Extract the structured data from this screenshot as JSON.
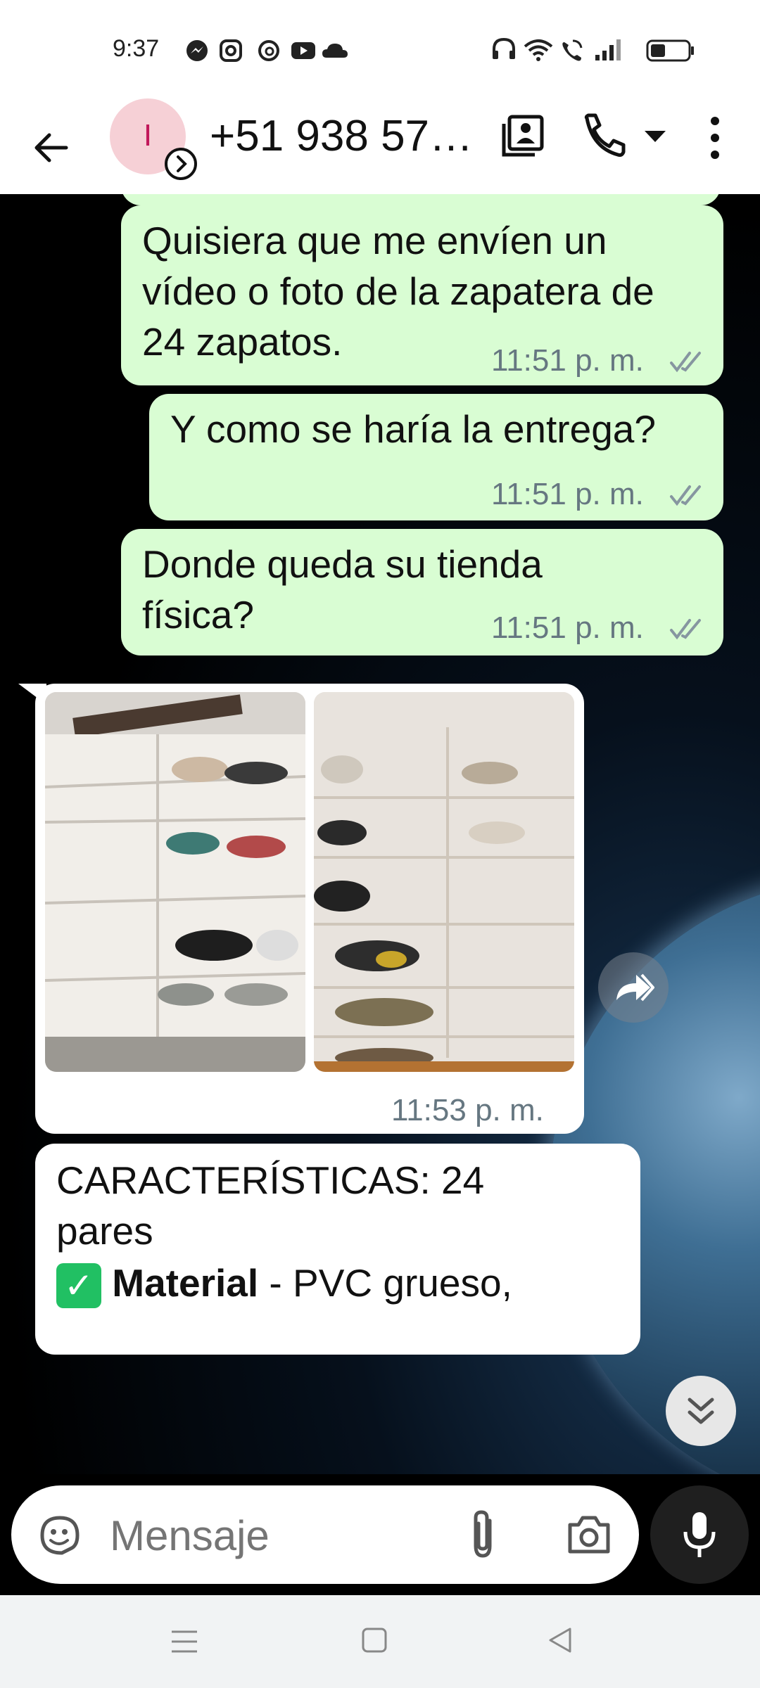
{
  "status_bar": {
    "time": "9:37",
    "left_icons": [
      "messenger-icon",
      "instagram-icon",
      "threads-icon",
      "youtube-icon",
      "cloud-icon"
    ],
    "right_icons": [
      "headphones-icon",
      "wifi-icon",
      "wifi-calling-icon",
      "signal-icon",
      "battery-icon"
    ]
  },
  "header": {
    "avatar_letter": "I",
    "contact": "+51 938 57…",
    "avatar_color": "#f6d0d6"
  },
  "messages": [
    {
      "text": "Quisiera que me envíen un vídeo o foto de la zapatera de 24 zapatos.",
      "time": "11:51 p. m."
    },
    {
      "text": "Y como se haría la entrega?",
      "time": "11:51 p. m."
    },
    {
      "text": "Donde queda su tienda física?",
      "time": "11:51 p. m."
    }
  ],
  "image_message": {
    "time": "11:53 p. m."
  },
  "text_message_in": {
    "line1": "CARACTERÍSTICAS: 24 pares",
    "emoji": "✅",
    "bold": "Material",
    "rest": " - PVC grueso,"
  },
  "composer": {
    "placeholder": "Mensaje"
  },
  "colors": {
    "outgoing_bubble": "#d9fdd3",
    "incoming_bubble": "#ffffff",
    "accent": "#53bdeb"
  }
}
